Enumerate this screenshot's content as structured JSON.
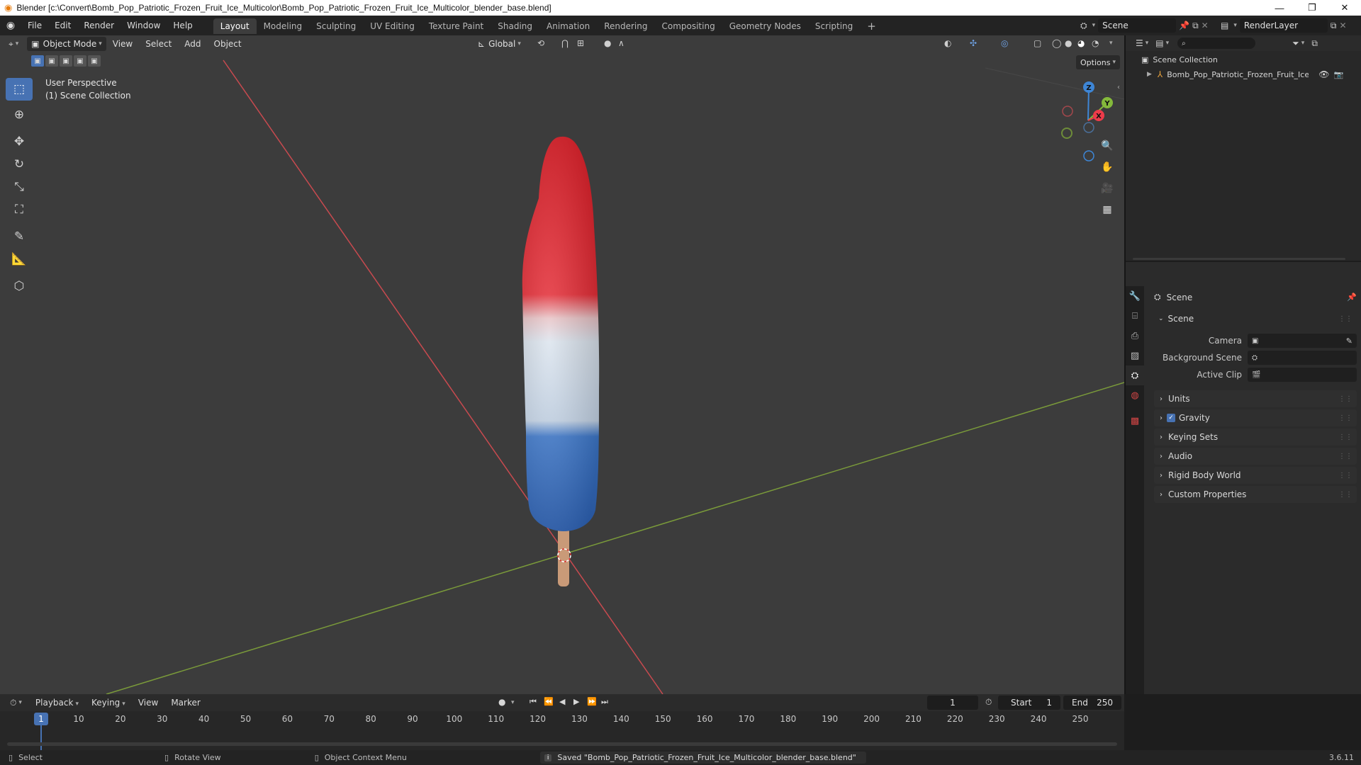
{
  "window": {
    "title": "Blender [c:\\Convert\\Bomb_Pop_Patriotic_Frozen_Fruit_Ice_Multicolor\\Bomb_Pop_Patriotic_Frozen_Fruit_Ice_Multicolor_blender_base.blend]"
  },
  "menu": [
    "File",
    "Edit",
    "Render",
    "Window",
    "Help"
  ],
  "workspaces": [
    "Layout",
    "Modeling",
    "Sculpting",
    "UV Editing",
    "Texture Paint",
    "Shading",
    "Animation",
    "Rendering",
    "Compositing",
    "Geometry Nodes",
    "Scripting"
  ],
  "active_workspace": "Layout",
  "scene_name": "Scene",
  "render_layer": "RenderLayer",
  "viewport": {
    "mode": "Object Mode",
    "menus": [
      "View",
      "Select",
      "Add",
      "Object"
    ],
    "transform_orientation": "Global",
    "options_label": "Options",
    "overlay_title": "User Perspective",
    "overlay_collection": "(1) Scene Collection",
    "gizmo_axes": [
      "Z",
      "Y",
      "X"
    ]
  },
  "outliner": {
    "root": "Scene Collection",
    "item": "Bomb_Pop_Patriotic_Frozen_Fruit_Ice_M"
  },
  "properties": {
    "context": "Scene",
    "section": "Scene",
    "fields": [
      {
        "label": "Camera",
        "value": ""
      },
      {
        "label": "Background Scene",
        "value": ""
      },
      {
        "label": "Active Clip",
        "value": ""
      }
    ],
    "panels": [
      "Units",
      "Gravity",
      "Keying Sets",
      "Audio",
      "Rigid Body World",
      "Custom Properties"
    ],
    "gravity_checked": true
  },
  "timeline": {
    "menus": [
      "Playback",
      "Keying",
      "View",
      "Marker"
    ],
    "current_frame": "1",
    "start_label": "Start",
    "start": "1",
    "end_label": "End",
    "end": "250",
    "ticks": [
      "1",
      "10",
      "20",
      "30",
      "40",
      "50",
      "60",
      "70",
      "80",
      "90",
      "100",
      "110",
      "120",
      "130",
      "140",
      "150",
      "160",
      "170",
      "180",
      "190",
      "200",
      "210",
      "220",
      "230",
      "240",
      "250"
    ]
  },
  "status": {
    "select": "Select",
    "rotate": "Rotate View",
    "context_menu": "Object Context Menu",
    "message": "Saved \"Bomb_Pop_Patriotic_Frozen_Fruit_Ice_Multicolor_blender_base.blend\"",
    "version": "3.6.11"
  },
  "colors": {
    "accent": "#4772b3",
    "x_axis": "#ee3b4a",
    "y_axis": "#84b93b",
    "z_axis": "#3e86d6",
    "pop_red": "#e8202a",
    "pop_white": "#dbe4ee",
    "pop_blue": "#3470c8"
  }
}
